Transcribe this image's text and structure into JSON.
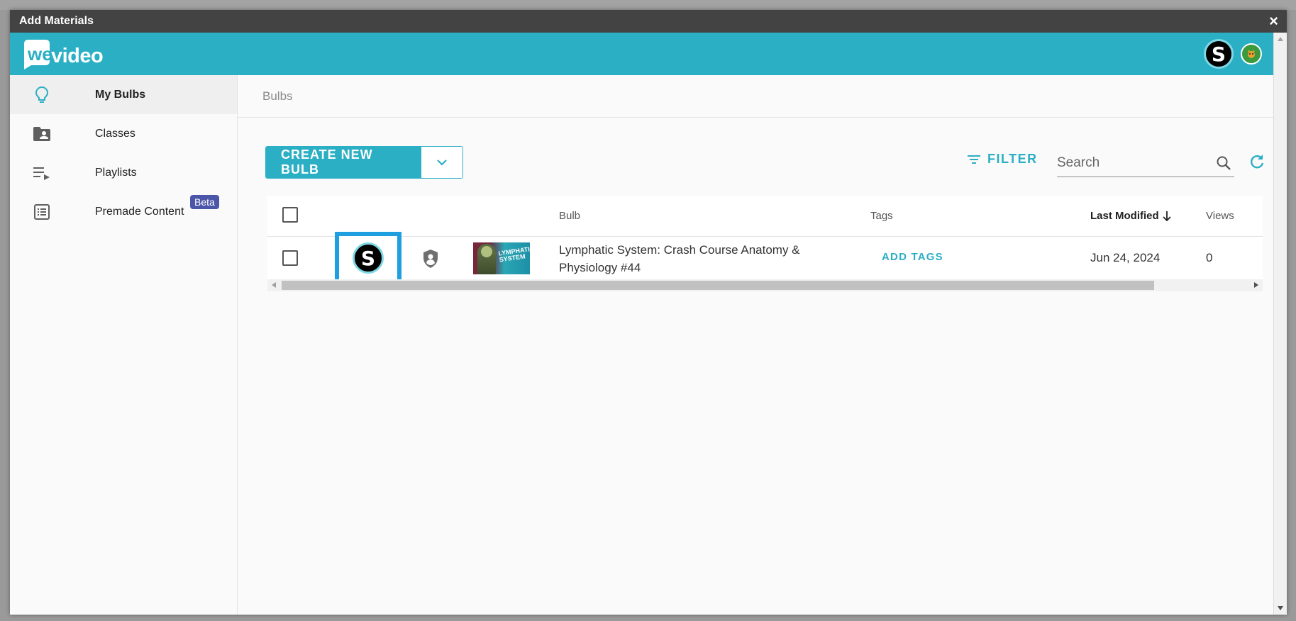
{
  "modal": {
    "title": "Add Materials",
    "close_label": "×"
  },
  "header": {
    "logo_text": "wevideo",
    "user_initial": "S"
  },
  "sidebar": {
    "items": [
      {
        "label": "My Bulbs",
        "icon": "lightbulb-icon",
        "active": true
      },
      {
        "label": "Classes",
        "icon": "folder-user-icon",
        "active": false
      },
      {
        "label": "Playlists",
        "icon": "playlist-icon",
        "active": false
      },
      {
        "label": "Premade Content",
        "icon": "list-box-icon",
        "active": false,
        "badge": "Beta"
      }
    ]
  },
  "main": {
    "breadcrumb": "Bulbs",
    "create_button_label": "CREATE NEW BULB",
    "filter_label": "FILTER",
    "search_placeholder": "Search"
  },
  "table": {
    "columns": {
      "bulb": "Bulb",
      "tags": "Tags",
      "last_modified": "Last Modified",
      "views": "Views"
    },
    "rows": [
      {
        "owner_initial": "S",
        "thumbnail_text": "LYMPHATIC SYSTEM",
        "title": "Lymphatic System: Crash Course Anatomy & Physiology #44",
        "tags_action": "ADD TAGS",
        "last_modified": "Jun 24, 2024",
        "views": "0"
      }
    ]
  },
  "colors": {
    "brand": "#2bafc4",
    "titlebar": "#434343",
    "highlight": "#1ea0e0",
    "beta": "#4b56a8"
  }
}
